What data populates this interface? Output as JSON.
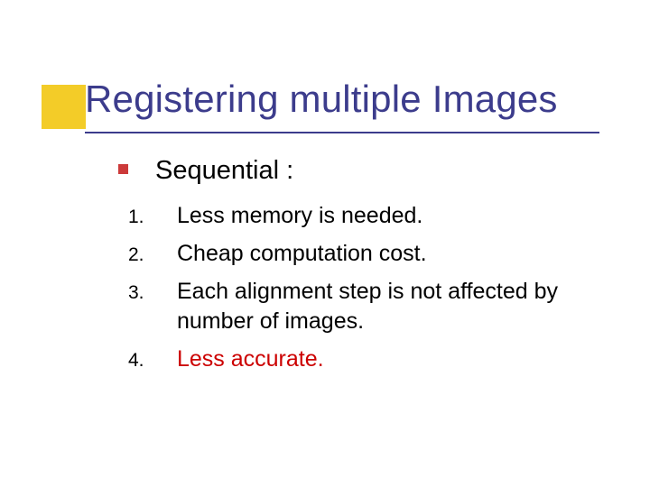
{
  "title": "Registering multiple Images",
  "subtitle": "Sequential :",
  "items": [
    {
      "n": "1.",
      "text": "Less memory is needed.",
      "neg": false
    },
    {
      "n": "2.",
      "text": "Cheap computation cost.",
      "neg": false
    },
    {
      "n": "3.",
      "text": "Each alignment step is not affected by number of images.",
      "neg": false
    },
    {
      "n": "4.",
      "text": "Less accurate.",
      "neg": true
    }
  ]
}
